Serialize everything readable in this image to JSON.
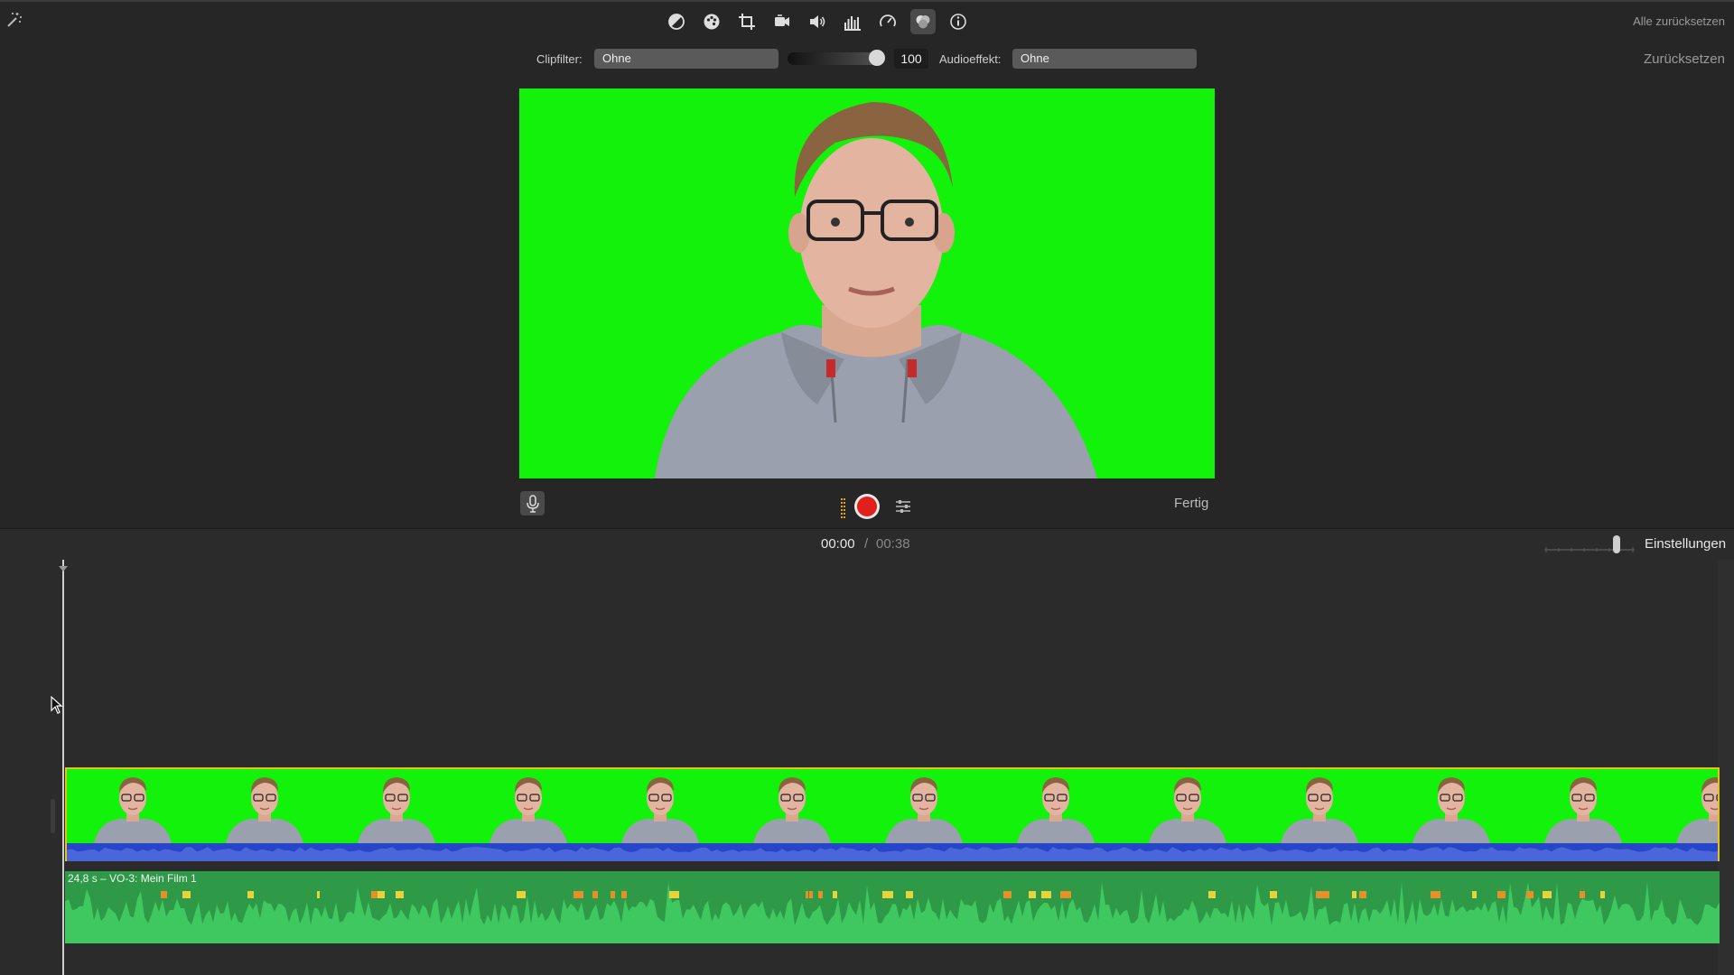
{
  "toolbar": {
    "icons": [
      "color-balance-icon",
      "color-correction-icon",
      "crop-icon",
      "stabilization-icon",
      "volume-icon",
      "equalizer-icon",
      "speed-icon",
      "noise-reduction-icon",
      "info-icon"
    ],
    "active_icon": "noise-reduction-icon",
    "reset_all_label": "Alle zurücksetzen",
    "reset_label": "Zurücksetzen"
  },
  "filters": {
    "clipfilter_label": "Clipfilter:",
    "clipfilter_value": "Ohne",
    "level_value": "100",
    "level_fraction": 0.9,
    "audioeffect_label": "Audioeffekt:",
    "audioeffect_value": "Ohne"
  },
  "voiceover": {
    "done_label": "Fertig",
    "record_color": "#e0201a"
  },
  "timecode": {
    "current": "00:00",
    "separator": "/",
    "total": "00:38",
    "settings_label": "Einstellungen"
  },
  "timeline": {
    "video_clip_background": "#12f20a",
    "video_clip_border": "#e2c21b",
    "thumbnail_count": 13,
    "voiceover_clip_label": "24,8 s – VO-3: Mein Film 1",
    "voiceover_color": "#2e9a48"
  }
}
